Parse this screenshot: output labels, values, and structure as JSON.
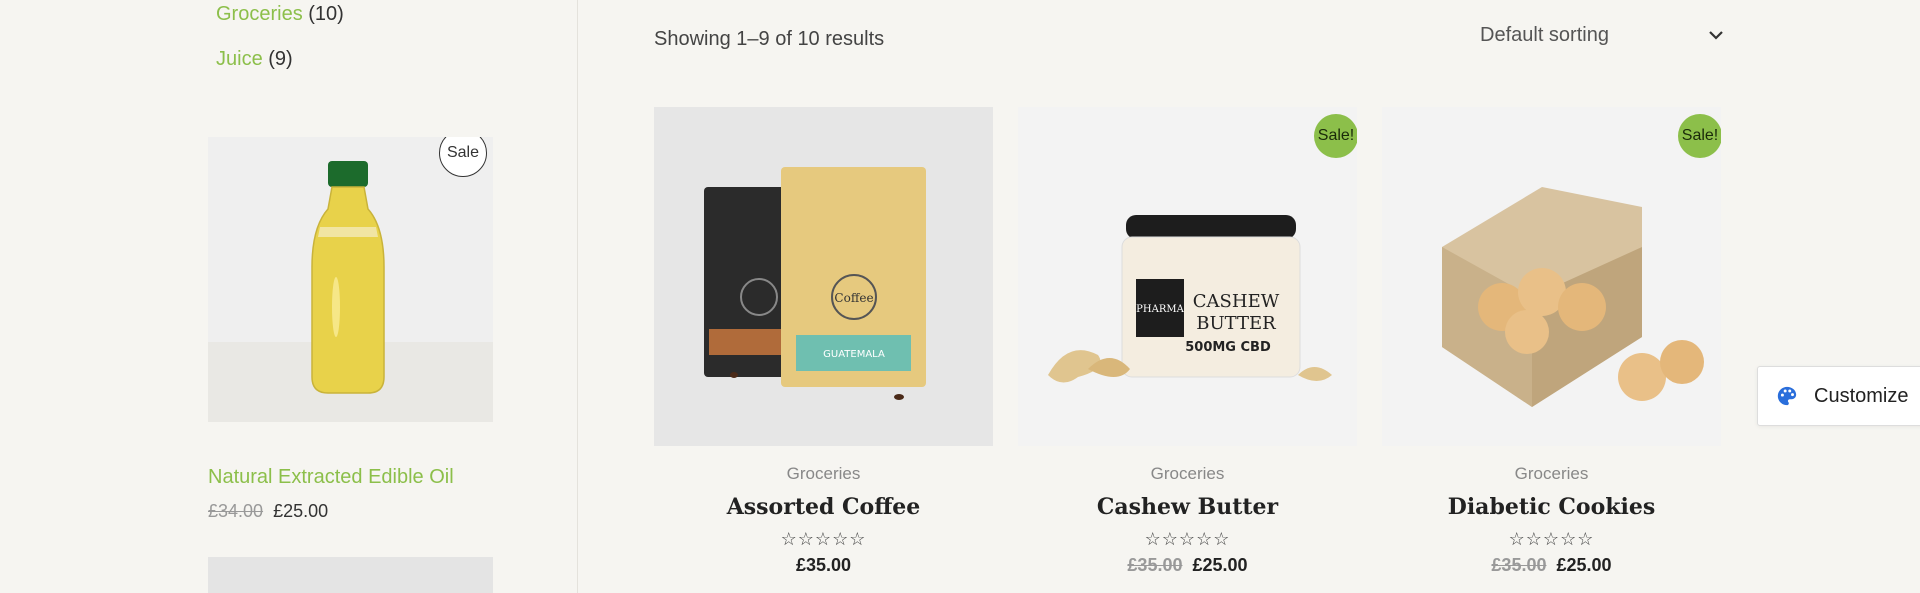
{
  "sidebar": {
    "categories": [
      {
        "name": "Groceries",
        "count": "(10)"
      },
      {
        "name": "Juice",
        "count": "(9)"
      }
    ],
    "featured": {
      "badge": "Sale",
      "title": "Natural Extracted Edible Oil",
      "old_price": "£34.00",
      "price": "£25.00"
    }
  },
  "toolbar": {
    "results_text": "Showing 1–9 of 10 results",
    "sorting": "Default sorting"
  },
  "products": [
    {
      "category": "Groceries",
      "title": "Assorted Coffee",
      "stars": "☆☆☆☆☆",
      "old_price": "",
      "price": "£35.00",
      "badge": ""
    },
    {
      "category": "Groceries",
      "title": "Cashew Butter",
      "stars": "☆☆☆☆☆",
      "old_price": "£35.00",
      "price": "£25.00",
      "badge": "Sale!"
    },
    {
      "category": "Groceries",
      "title": "Diabetic Cookies",
      "stars": "☆☆☆☆☆",
      "old_price": "£35.00",
      "price": "£25.00",
      "badge": "Sale!"
    }
  ],
  "product_image_labels": {
    "coffee_bag": "Coffee",
    "coffee_origin": "GUATEMALA",
    "cashew_line1": "CASHEW",
    "cashew_line2": "BUTTER",
    "cashew_line3": "500MG CBD",
    "cashew_brand": "PHARMA"
  },
  "customize": {
    "label": "Customize"
  },
  "colors": {
    "accent": "#8cbf4a",
    "background": "#f6f5f1"
  }
}
